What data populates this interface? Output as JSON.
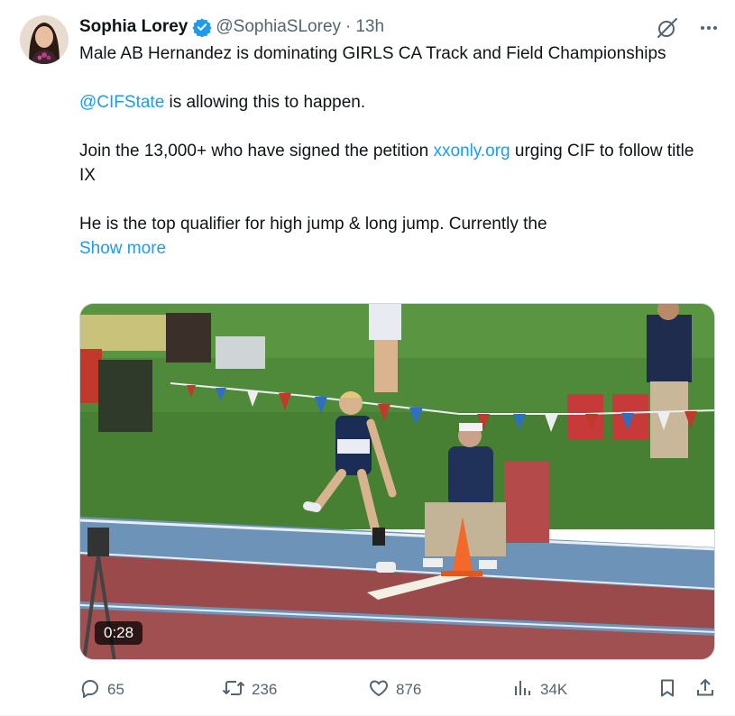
{
  "tweet": {
    "author_name": "Sophia Lorey",
    "handle": "@SophiaSLorey",
    "separator": "·",
    "time": "13h",
    "lines": {
      "line1": "Male AB Hernandez is dominating GIRLS CA Track and Field Championships",
      "line2_link": "@CIFState",
      "line2_rest": " is allowing this to happen.",
      "line3_pre": "Join the 13,000+ who have signed the petition ",
      "line3_link": "xxonly.org",
      "line3_post": " urging CIF to follow title IX",
      "line4": "He is the top qualifier for high jump & long jump. Currently the"
    },
    "show_more": "Show more"
  },
  "media": {
    "duration": "0:28"
  },
  "actions": {
    "replies": "65",
    "reposts": "236",
    "likes": "876",
    "views": "34K"
  },
  "colors": {
    "link": "#1d9bf0",
    "verified": "#1d9bf0",
    "secondary": "#536471"
  },
  "icons": [
    "verified-badge-icon",
    "grok-icon",
    "more-icon",
    "reply-icon",
    "repost-icon",
    "like-icon",
    "views-icon",
    "bookmark-icon",
    "share-icon"
  ]
}
